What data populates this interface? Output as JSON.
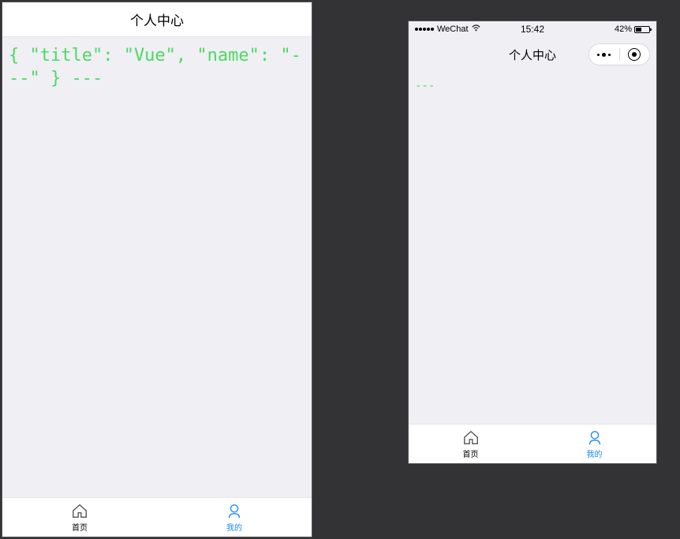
{
  "left_phone": {
    "header_title": "个人中心",
    "content_text": "{ \"title\": \"Vue\", \"name\": \"---\" } ---",
    "tabs": [
      {
        "label": "首页",
        "icon_name": "home-icon",
        "active": false
      },
      {
        "label": "我的",
        "icon_name": "user-icon",
        "active": true
      }
    ]
  },
  "right_phone": {
    "statusbar": {
      "carrier": "WeChat",
      "time": "15:42",
      "battery_pct": "42%"
    },
    "header_title": "个人中心",
    "content_text": "---",
    "tabs": [
      {
        "label": "首页",
        "icon_name": "home-icon",
        "active": false
      },
      {
        "label": "我的",
        "icon_name": "user-icon",
        "active": true
      }
    ]
  }
}
